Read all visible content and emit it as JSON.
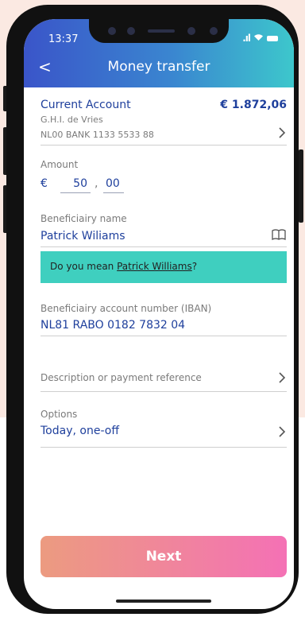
{
  "status": {
    "time": "13:37",
    "signal": " . ıl",
    "wifi": "◌"
  },
  "header": {
    "title": "Money transfer",
    "back": "<"
  },
  "account": {
    "name": "Current Account",
    "balance": "€ 1.872,06",
    "holder": "G.H.I. de Vries",
    "iban": "NL00 BANK 1133 5533 88"
  },
  "amount": {
    "label": "Amount",
    "currency": "€",
    "whole": "50",
    "sep": ",",
    "cents": "00"
  },
  "beneficiary": {
    "label": "Beneficiairy name",
    "value": "Patrick Wiliams"
  },
  "suggestion": {
    "prefix": "Do you mean ",
    "name": "Patrick Williams",
    "suffix": "?"
  },
  "iban_field": {
    "label": "Beneficiairy account number (IBAN)",
    "value": "NL81 RABO 0182 7832 04"
  },
  "description": {
    "label": "Description or payment reference"
  },
  "options": {
    "label": "Options",
    "value": "Today, one-off"
  },
  "next": {
    "label": "Next"
  },
  "colors": {
    "accent_blue": "#1e3f9c",
    "banner": "#3fcfbf",
    "header_start": "#3a55c9",
    "header_end": "#3dc7cc",
    "button_start": "#ec9b80",
    "button_end": "#f471b5"
  }
}
